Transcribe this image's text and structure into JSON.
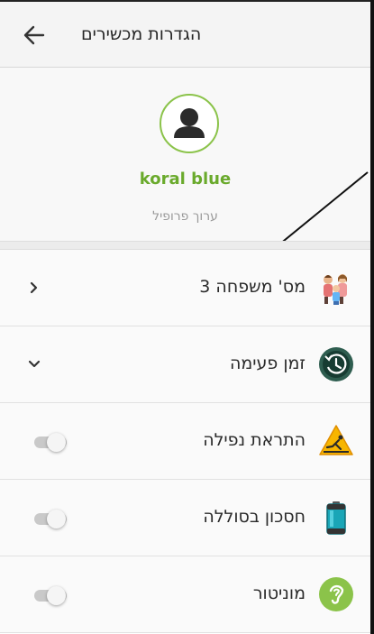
{
  "header": {
    "title": "הגדרות מכשירים",
    "back_icon": "arrow-left-icon"
  },
  "profile": {
    "name": "koral blue",
    "edit_label": "ערוך פרופיל",
    "avatar_icon": "user-avatar-icon"
  },
  "settings": [
    {
      "label": "מס' משפחה 3",
      "icon": "family-icon",
      "control": "chevron-right"
    },
    {
      "label": "זמן פעימה",
      "icon": "clock-history-icon",
      "control": "chevron-down"
    },
    {
      "label": "התראת נפילה",
      "icon": "fall-warning-icon",
      "control": "toggle",
      "on": false
    },
    {
      "label": "חסכון בסוללה",
      "icon": "battery-icon",
      "control": "toggle",
      "on": false
    },
    {
      "label": "מוניטור",
      "icon": "ear-icon",
      "control": "toggle",
      "on": false
    }
  ],
  "colors": {
    "accent_green": "#6aaa2c",
    "avatar_border": "#8bc34a",
    "toggle_off": "#c9c9c9"
  }
}
